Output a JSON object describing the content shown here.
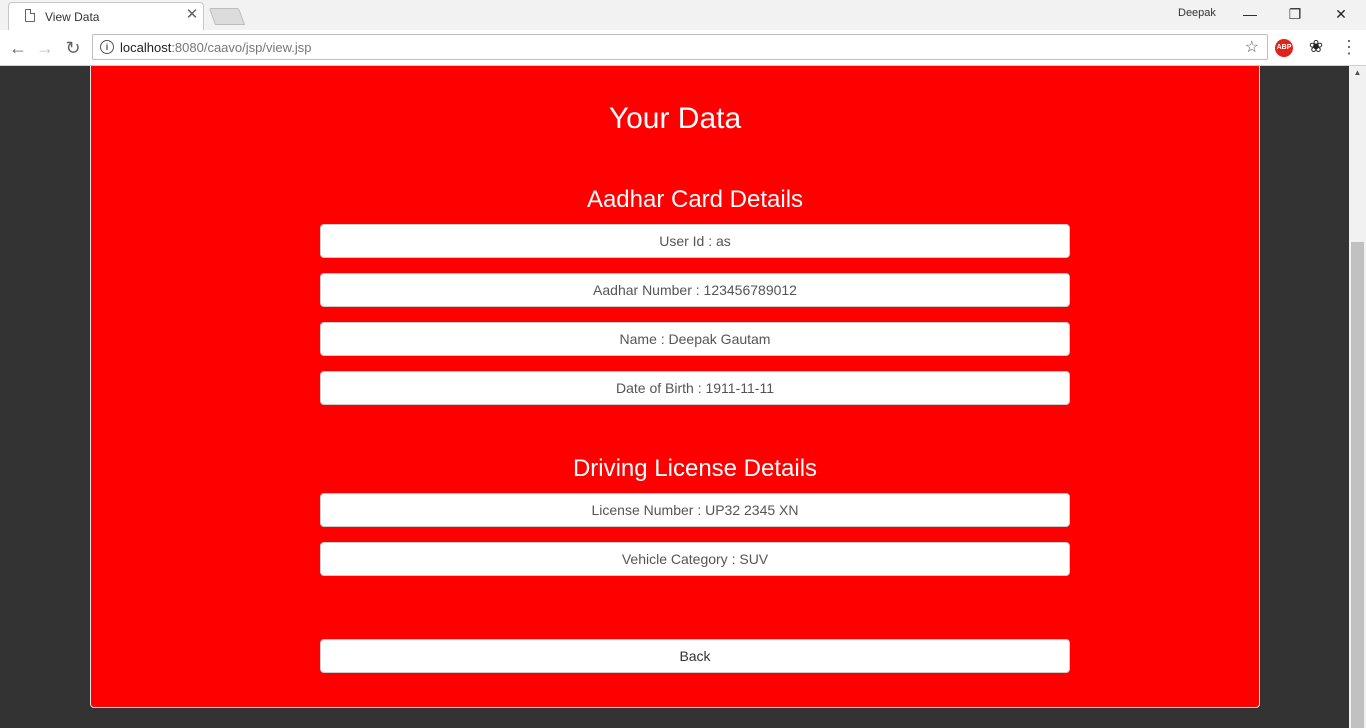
{
  "browser": {
    "tab_title": "View Data",
    "profile_name": "Deepak",
    "url_host": "localhost",
    "url_rest": ":8080/caavo/jsp/view.jsp",
    "extension_abp_label": "ABP",
    "icons": {
      "tab_page": "page-icon",
      "tab_close": "close-icon",
      "back": "arrow-left-icon",
      "forward": "arrow-right-icon",
      "reload": "reload-icon",
      "info": "info-icon",
      "bookmark": "star-icon",
      "adblock": "adblock-icon",
      "extension": "extension-icon",
      "menu": "menu-icon"
    }
  },
  "page": {
    "title": "Your Data",
    "background_color": "#ff0000",
    "aadhar": {
      "heading": "Aadhar Card Details",
      "user_id": "User Id : as",
      "aadhar_number": "Aadhar Number : 123456789012",
      "name": "Name : Deepak Gautam",
      "dob": "Date of Birth : 1911-11-11"
    },
    "license": {
      "heading": "Driving License Details",
      "license_number": "License Number : UP32 2345 XN",
      "vehicle_category": "Vehicle Category : SUV"
    },
    "back_label": "Back"
  }
}
